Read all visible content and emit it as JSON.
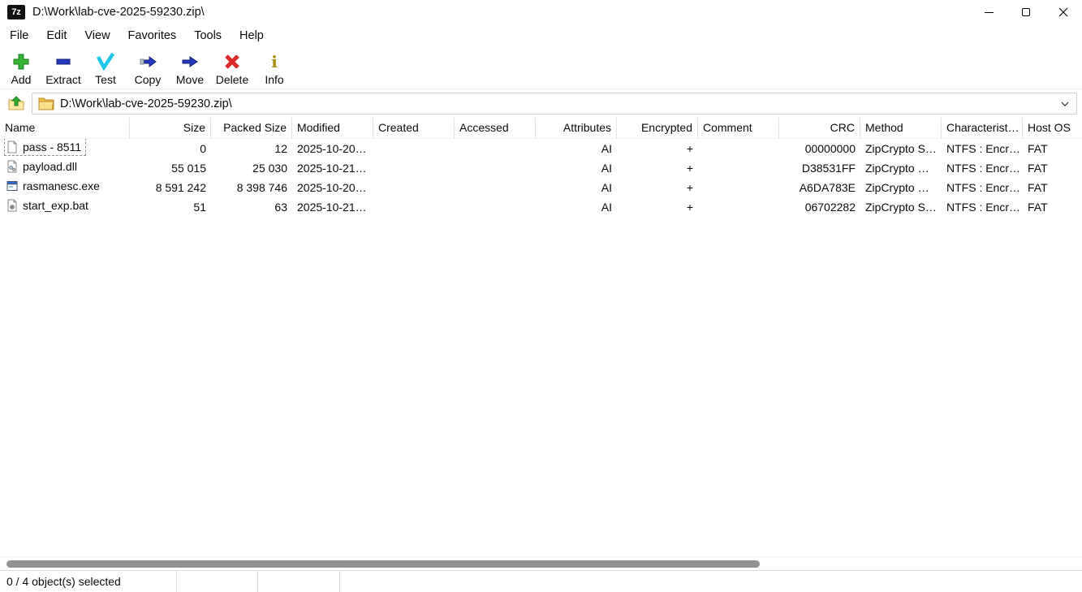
{
  "window": {
    "title": "D:\\Work\\lab-cve-2025-59230.zip\\",
    "app_icon_text": "7z"
  },
  "menu": {
    "items": [
      "File",
      "Edit",
      "View",
      "Favorites",
      "Tools",
      "Help"
    ]
  },
  "toolbar": {
    "buttons": [
      {
        "label": "Add",
        "icon": "add-icon"
      },
      {
        "label": "Extract",
        "icon": "extract-icon"
      },
      {
        "label": "Test",
        "icon": "test-icon"
      },
      {
        "label": "Copy",
        "icon": "copy-icon"
      },
      {
        "label": "Move",
        "icon": "move-icon"
      },
      {
        "label": "Delete",
        "icon": "delete-icon"
      },
      {
        "label": "Info",
        "icon": "info-icon"
      }
    ]
  },
  "address_bar": {
    "path": "D:\\Work\\lab-cve-2025-59230.zip\\"
  },
  "file_list": {
    "columns": [
      {
        "key": "name",
        "label": "Name",
        "align": "left"
      },
      {
        "key": "size",
        "label": "Size",
        "align": "right"
      },
      {
        "key": "packed_size",
        "label": "Packed Size",
        "align": "right"
      },
      {
        "key": "modified",
        "label": "Modified",
        "align": "left"
      },
      {
        "key": "created",
        "label": "Created",
        "align": "left"
      },
      {
        "key": "accessed",
        "label": "Accessed",
        "align": "left"
      },
      {
        "key": "attributes",
        "label": "Attributes",
        "align": "right"
      },
      {
        "key": "encrypted",
        "label": "Encrypted",
        "align": "right"
      },
      {
        "key": "comment",
        "label": "Comment",
        "align": "left"
      },
      {
        "key": "crc",
        "label": "CRC",
        "align": "right"
      },
      {
        "key": "method",
        "label": "Method",
        "align": "left"
      },
      {
        "key": "characteristics",
        "label": "Characterist…",
        "align": "left"
      },
      {
        "key": "host_os",
        "label": "Host OS",
        "align": "left"
      }
    ],
    "rows": [
      {
        "icon": "text-file-icon",
        "focused": true,
        "name": "pass - 8511",
        "size": "0",
        "packed_size": "12",
        "modified": "2025-10-20…",
        "created": "",
        "accessed": "",
        "attributes": "AI",
        "encrypted": "+",
        "comment": "",
        "crc": "00000000",
        "method": "ZipCrypto S…",
        "characteristics": "NTFS : Encr…",
        "host_os": "FAT"
      },
      {
        "icon": "dll-file-icon",
        "focused": false,
        "name": "payload.dll",
        "size": "55 015",
        "packed_size": "25 030",
        "modified": "2025-10-21…",
        "created": "",
        "accessed": "",
        "attributes": "AI",
        "encrypted": "+",
        "comment": "",
        "crc": "D38531FF",
        "method": "ZipCrypto …",
        "characteristics": "NTFS : Encr…",
        "host_os": "FAT"
      },
      {
        "icon": "exe-file-icon",
        "focused": false,
        "name": "rasmanesc.exe",
        "size": "8 591 242",
        "packed_size": "8 398 746",
        "modified": "2025-10-20…",
        "created": "",
        "accessed": "",
        "attributes": "AI",
        "encrypted": "+",
        "comment": "",
        "crc": "A6DA783E",
        "method": "ZipCrypto …",
        "characteristics": "NTFS : Encr…",
        "host_os": "FAT"
      },
      {
        "icon": "bat-file-icon",
        "focused": false,
        "name": "start_exp.bat",
        "size": "51",
        "packed_size": "63",
        "modified": "2025-10-21…",
        "created": "",
        "accessed": "",
        "attributes": "AI",
        "encrypted": "+",
        "comment": "",
        "crc": "06702282",
        "method": "ZipCrypto S…",
        "characteristics": "NTFS : Encr…",
        "host_os": "FAT"
      }
    ]
  },
  "status_bar": {
    "text": "0 / 4 object(s) selected"
  }
}
